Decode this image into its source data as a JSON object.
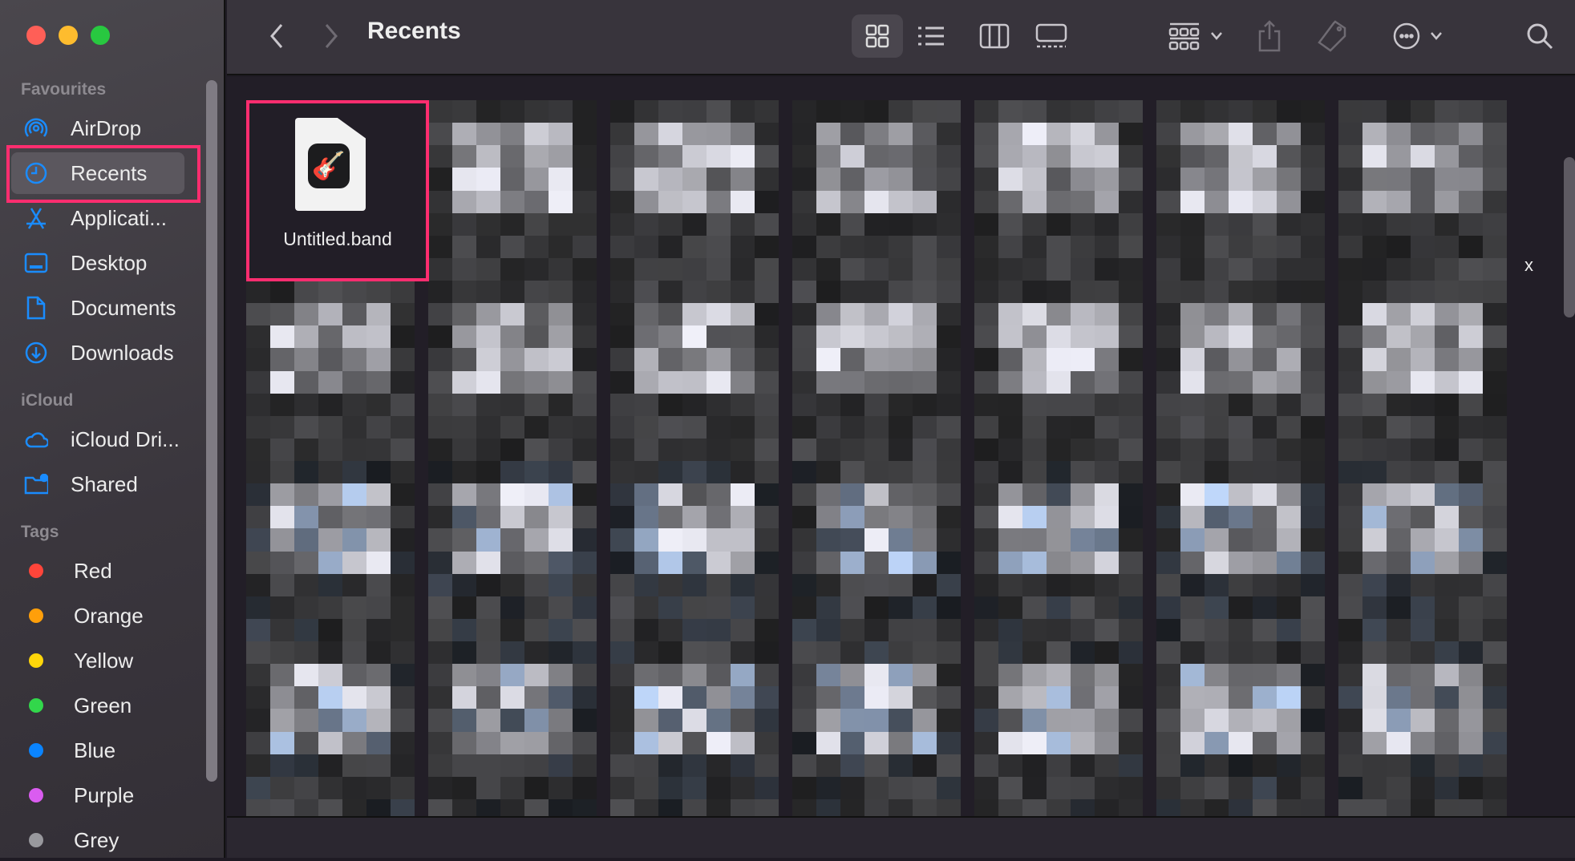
{
  "window": {
    "title": "Recents",
    "traffic_lights": [
      "#ff5f57",
      "#febc2e",
      "#28c840"
    ]
  },
  "sidebar": {
    "sections": [
      {
        "label": "Favourites",
        "items": [
          {
            "label": "AirDrop",
            "icon": "airdrop-icon"
          },
          {
            "label": "Recents",
            "icon": "clock-icon",
            "selected": true
          },
          {
            "label": "Applicati...",
            "icon": "applications-icon"
          },
          {
            "label": "Desktop",
            "icon": "desktop-icon"
          },
          {
            "label": "Documents",
            "icon": "document-icon"
          },
          {
            "label": "Downloads",
            "icon": "download-icon"
          }
        ]
      },
      {
        "label": "iCloud",
        "items": [
          {
            "label": "iCloud Dri...",
            "icon": "cloud-icon"
          },
          {
            "label": "Shared",
            "icon": "shared-folder-icon"
          }
        ]
      },
      {
        "label": "Tags",
        "items": [
          {
            "label": "Red",
            "color": "#ff453a"
          },
          {
            "label": "Orange",
            "color": "#ff9f0a"
          },
          {
            "label": "Yellow",
            "color": "#ffd60a"
          },
          {
            "label": "Green",
            "color": "#32d74b"
          },
          {
            "label": "Blue",
            "color": "#0a84ff"
          },
          {
            "label": "Purple",
            "color": "#da5cf0"
          },
          {
            "label": "Grey",
            "color": "#98989d"
          }
        ]
      }
    ]
  },
  "toolbar": {
    "view_modes": [
      "icon-view",
      "list-view",
      "column-view",
      "gallery-view"
    ],
    "active_view": "icon-view",
    "group_icon": "group-icon",
    "share_icon": "share-icon",
    "tag_icon": "tag-icon",
    "more_icon": "ellipsis-circle-icon",
    "search_icon": "search-icon"
  },
  "files": {
    "first": {
      "name": "Untitled.band",
      "icon": "garageband-file-icon"
    },
    "stray_text": "x",
    "blurred_count": 27
  },
  "highlight_color": "#ff2d6f"
}
